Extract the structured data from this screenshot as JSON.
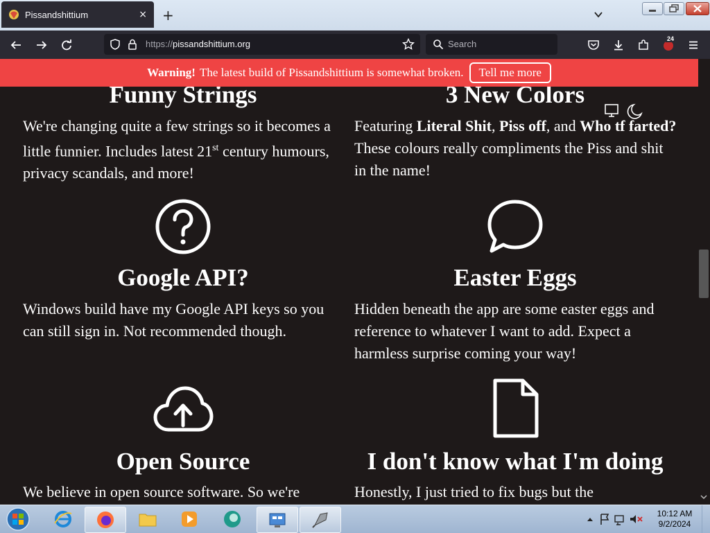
{
  "browser": {
    "tab_title": "Pissandshittium",
    "tab_close": "×",
    "new_tab": "+",
    "url_protocol": "https://",
    "url_host": "pissandshittium.org",
    "search_placeholder": "Search",
    "notification_badge": "24"
  },
  "page": {
    "warning_label": "Warning!",
    "warning_text": "The latest build of Pissandshittium is somewhat broken.",
    "warning_button": "Tell me more",
    "features": {
      "funny_strings": {
        "title": "Funny Strings",
        "desc_a": "We're changing quite a few strings so it becomes a little funnier. Includes latest 21",
        "desc_sup": "st",
        "desc_b": " century humours, privacy scandals, and more!"
      },
      "new_colors": {
        "title": "3 New Colors",
        "desc_a": "Featuring ",
        "color1": "Literal Shit",
        "sep1": ", ",
        "color2": "Piss off",
        "sep2": ", and ",
        "color3": "Who tf farted?",
        "desc_b": " These colours really compliments the Piss and shit in the name!"
      },
      "google_api": {
        "title": "Google API?",
        "desc": "Windows build have my Google API keys so you can still sign in. Not recommended though."
      },
      "easter_eggs": {
        "title": "Easter Eggs",
        "desc": "Hidden beneath the app are some easter eggs and reference to whatever I want to add. Expect a harmless surprise coming your way!"
      },
      "open_source": {
        "title": "Open Source",
        "desc": "We believe in open source software. So we're"
      },
      "dont_know": {
        "title": "I don't know what I'm doing",
        "desc": "Honestly, I just tried to fix bugs but the"
      }
    }
  },
  "taskbar": {
    "time": "10:12 AM",
    "date": "9/2/2024"
  },
  "colors": {
    "page_bg": "#1e1919",
    "warning_bg": "#ef4444",
    "chrome_bg": "#2b2a33"
  }
}
